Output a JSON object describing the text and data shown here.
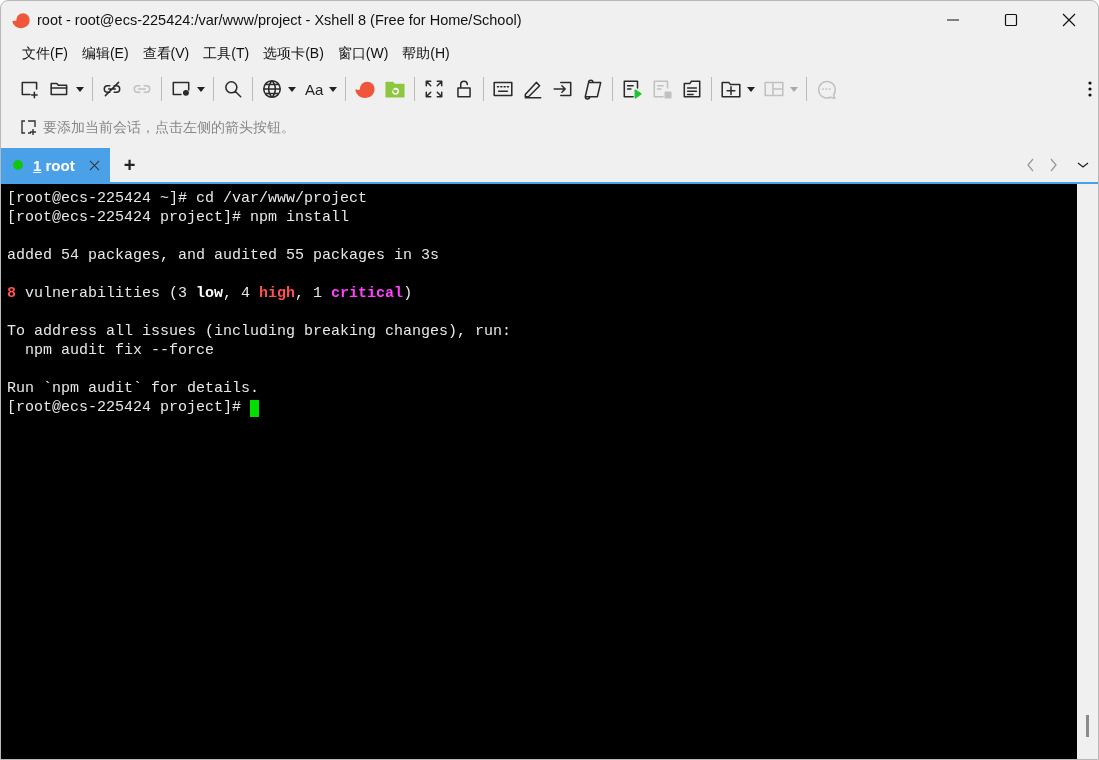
{
  "window": {
    "title": "root - root@ecs-225424:/var/www/project - Xshell 8 (Free for Home/School)"
  },
  "menu": [
    "文件(F)",
    "编辑(E)",
    "查看(V)",
    "工具(T)",
    "选项卡(B)",
    "窗口(W)",
    "帮助(H)"
  ],
  "toolbar": [
    {
      "items": [
        {
          "disabled": false,
          "dropdown": false
        },
        {
          "disabled": false,
          "dropdown": true
        }
      ]
    },
    {
      "items": [
        {
          "disabled": false,
          "dropdown": false
        },
        {
          "disabled": true,
          "dropdown": false
        }
      ]
    },
    {
      "items": [
        {
          "disabled": false,
          "dropdown": true
        }
      ]
    },
    {
      "items": [
        {
          "disabled": false,
          "dropdown": false
        }
      ]
    },
    {
      "items": [
        {
          "disabled": false,
          "dropdown": true
        },
        {
          "disabled": false,
          "dropdown": true,
          "label": "Aa"
        }
      ]
    },
    {
      "items": [
        {
          "disabled": false,
          "dropdown": false
        },
        {
          "disabled": false,
          "dropdown": false
        }
      ]
    },
    {
      "items": [
        {
          "disabled": false,
          "dropdown": false
        },
        {
          "disabled": false,
          "dropdown": false
        }
      ]
    },
    {
      "items": [
        {
          "disabled": false,
          "dropdown": false
        },
        {
          "disabled": false,
          "dropdown": false
        },
        {
          "disabled": false,
          "dropdown": false
        },
        {
          "disabled": false,
          "dropdown": false
        }
      ]
    },
    {
      "items": [
        {
          "disabled": false,
          "dropdown": false
        },
        {
          "disabled": true,
          "dropdown": false
        },
        {
          "disabled": false,
          "dropdown": false
        }
      ]
    },
    {
      "items": [
        {
          "disabled": false,
          "dropdown": true
        },
        {
          "disabled": true,
          "dropdown": true
        }
      ]
    },
    {
      "items": [
        {
          "disabled": true,
          "dropdown": false
        }
      ]
    }
  ],
  "address_bar": {
    "placeholder": "要添加当前会话，点击左侧的箭头按钮。"
  },
  "tabs": [
    {
      "number": "1",
      "label": "root",
      "selected": true,
      "connected": true
    }
  ],
  "add_tab": "+",
  "terminal": {
    "lines": [
      {
        "blank_before": false,
        "segments": [
          {
            "kind": "plain",
            "text": "[root@ecs-225424 ~]# cd /var/www/project"
          }
        ]
      },
      {
        "blank_before": false,
        "segments": [
          {
            "kind": "plain",
            "text": "[root@ecs-225424 project]# npm install"
          }
        ]
      },
      {
        "blank_before": true,
        "segments": [
          {
            "kind": "plain",
            "text": "added 54 packages, and audited 55 packages in 3s"
          }
        ]
      },
      {
        "blank_before": true,
        "segments": [
          {
            "kind": "red",
            "text": "8"
          },
          {
            "kind": "plain",
            "text": " vulnerabilities (3 "
          },
          {
            "kind": "bold",
            "text": "low"
          },
          {
            "kind": "plain",
            "text": ", 4 "
          },
          {
            "kind": "red",
            "text": "high"
          },
          {
            "kind": "plain",
            "text": ", 1 "
          },
          {
            "kind": "magenta",
            "text": "critical"
          },
          {
            "kind": "plain",
            "text": ")"
          }
        ]
      },
      {
        "blank_before": true,
        "segments": [
          {
            "kind": "plain",
            "text": "To address all issues (including breaking changes), run:"
          }
        ]
      },
      {
        "blank_before": false,
        "segments": [
          {
            "kind": "plain",
            "text": "  npm audit fix --force"
          }
        ]
      },
      {
        "blank_before": true,
        "segments": [
          {
            "kind": "plain",
            "text": "Run `npm audit` for details."
          }
        ]
      },
      {
        "blank_before": false,
        "segments": [
          {
            "kind": "plain",
            "text": "[root@ecs-225424 project]# "
          }
        ]
      }
    ],
    "cursor": true
  }
}
